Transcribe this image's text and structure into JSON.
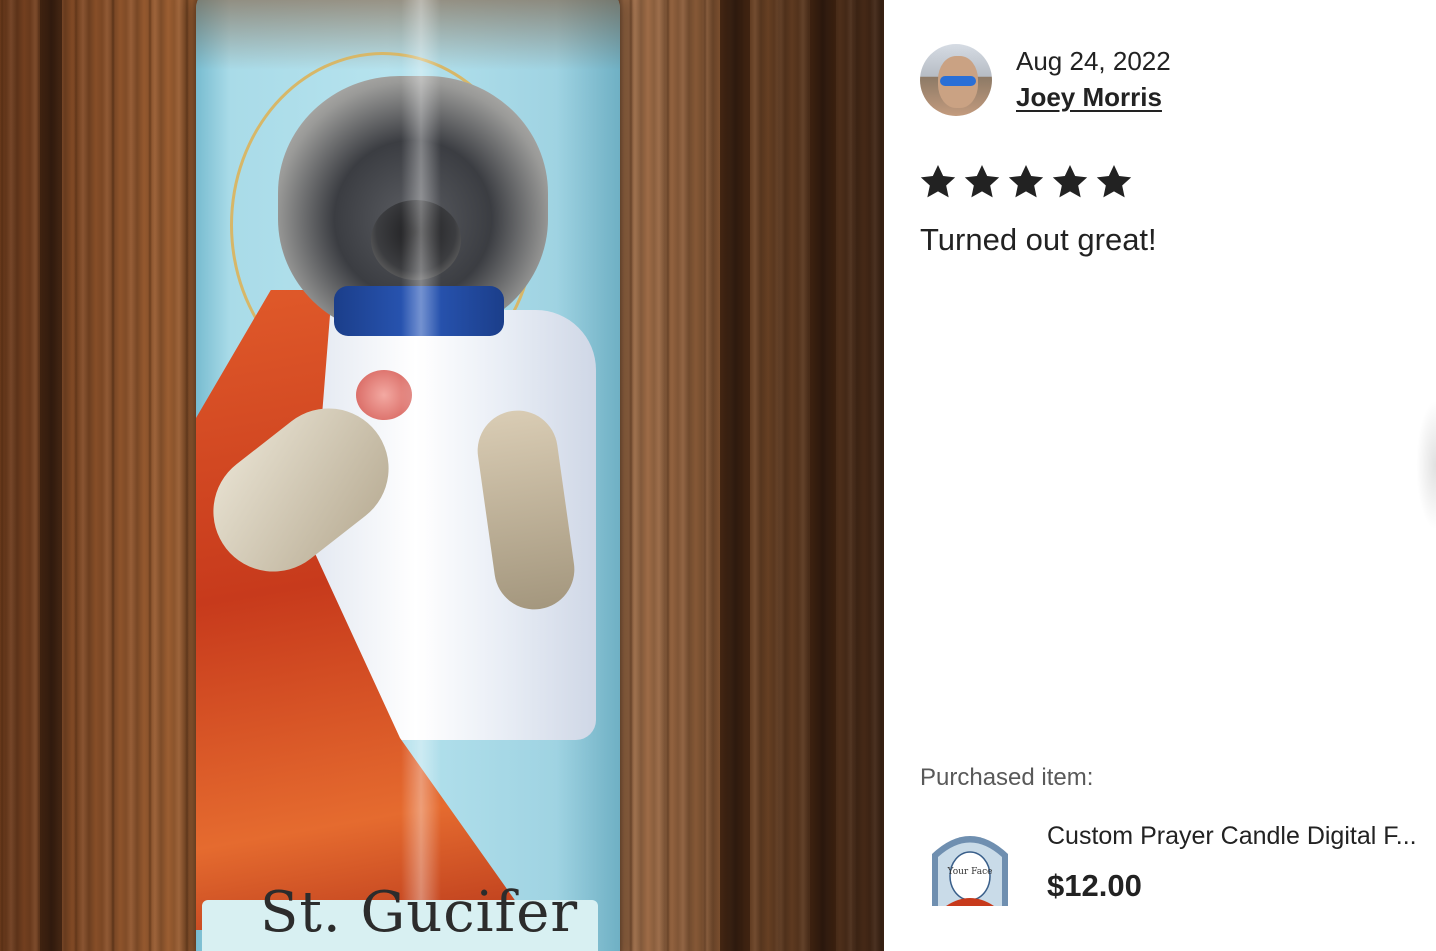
{
  "review_photo": {
    "alt_image": "review-photo",
    "label_text": "St. Gucifer"
  },
  "review": {
    "date": "Aug 24, 2022",
    "reviewer_name": "Joey Morris",
    "rating": 5,
    "rating_max": 5,
    "text": "Turned out great!"
  },
  "purchased": {
    "label": "Purchased item:",
    "item_title": "Custom Prayer Candle Digital F...",
    "item_price": "$12.00",
    "thumb_caption": "Your Face"
  },
  "colors": {
    "star": "#222222",
    "text": "#222222",
    "muted": "#595959"
  }
}
